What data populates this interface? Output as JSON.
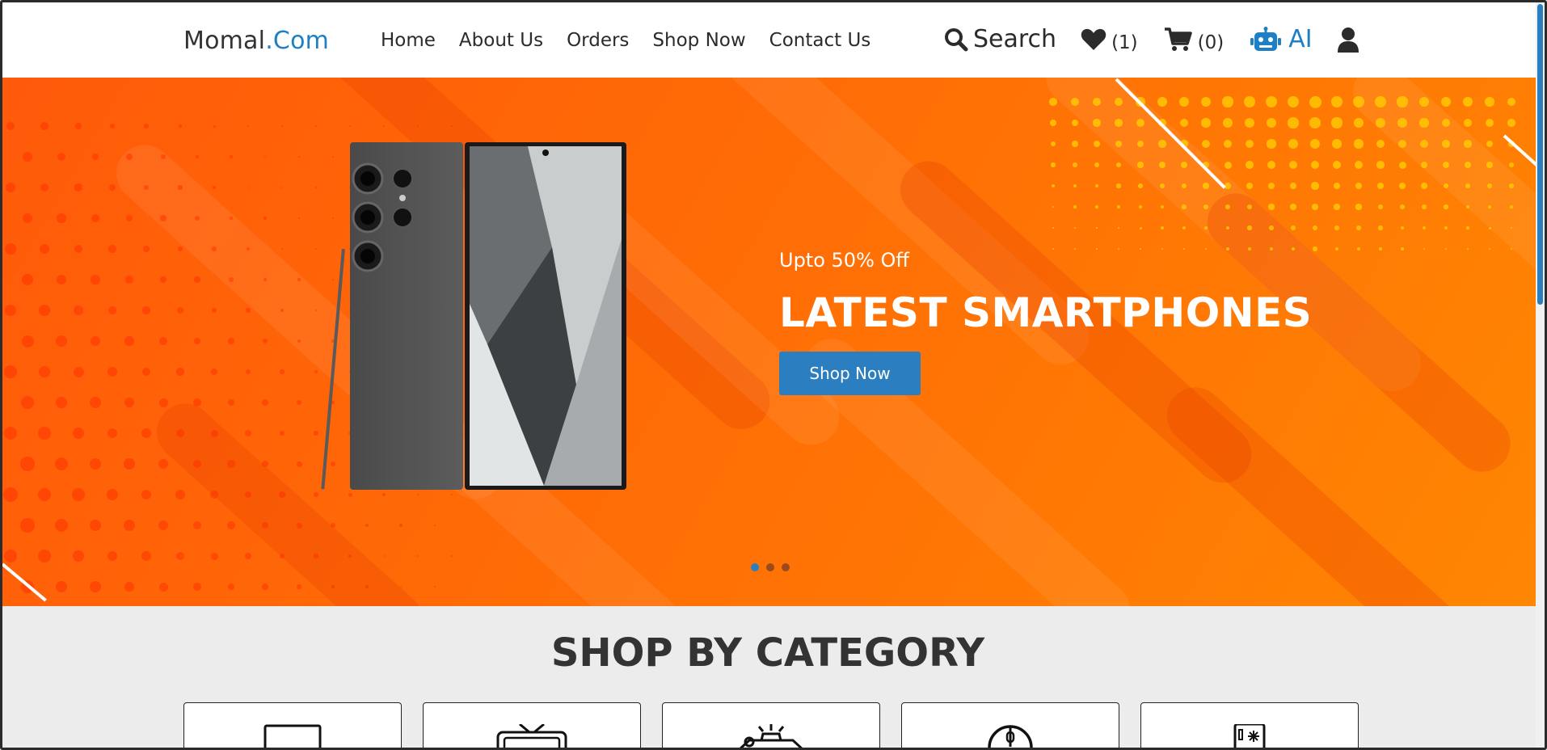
{
  "brand": {
    "name": "Momal",
    "suffix": ".Com"
  },
  "nav": {
    "links": [
      "Home",
      "About Us",
      "Orders",
      "Shop Now",
      "Contact Us"
    ],
    "search_label": "Search",
    "wishlist_count": "(1)",
    "cart_count": "(0)",
    "ai_label": "AI"
  },
  "hero": {
    "promo": "Upto 50% Off",
    "title": "LATEST SMARTPHONES",
    "button_label": "Shop Now",
    "slides": 3,
    "active_slide": 1
  },
  "categories": {
    "title": "SHOP BY CATEGORY",
    "icons": [
      "laptop-icon",
      "tv-icon",
      "car-alarm-icon",
      "mouse-icon",
      "refrigerator-icon"
    ]
  },
  "colors": {
    "accent": "#1e7fc4",
    "hero_orange": "#ff6a06",
    "button": "#2b7fc0"
  }
}
